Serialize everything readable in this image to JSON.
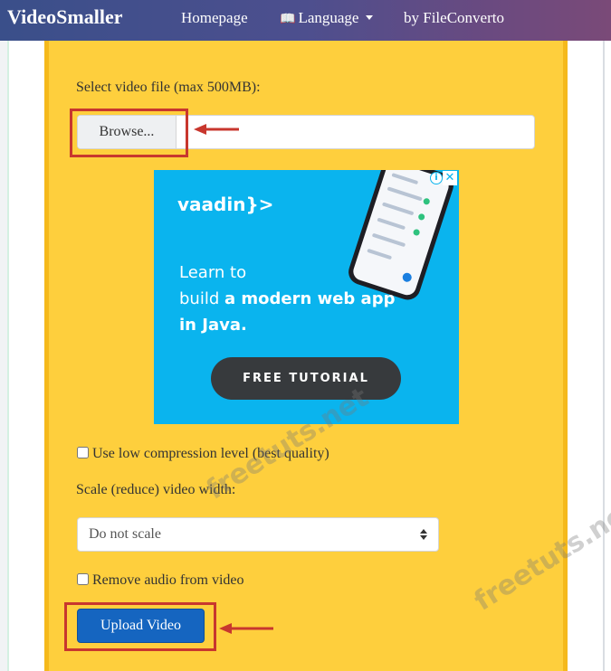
{
  "navbar": {
    "brand": "VideoSmaller",
    "links": {
      "homepage": "Homepage",
      "language": "Language",
      "by": "by FileConverto"
    }
  },
  "form": {
    "select_label": "Select video file (max 500MB):",
    "browse_label": "Browse...",
    "low_compression_label": "Use low compression level (best quality)",
    "scale_label": "Scale (reduce) video width:",
    "scale_selected": "Do not scale",
    "remove_audio_label": "Remove audio from video",
    "upload_label": "Upload Video"
  },
  "ad": {
    "logo": "vaadin}>",
    "line1": "Learn to",
    "line2_pre": "build ",
    "line2_bold": "a modern web app",
    "line3_bold": "in Java.",
    "cta": "FREE TUTORIAL"
  },
  "watermark": "freetuts.net",
  "colors": {
    "card_bg": "#fecf3d",
    "highlight": "#c8372e",
    "upload_btn": "#1565c0",
    "ad_bg": "#0ab4ee"
  }
}
